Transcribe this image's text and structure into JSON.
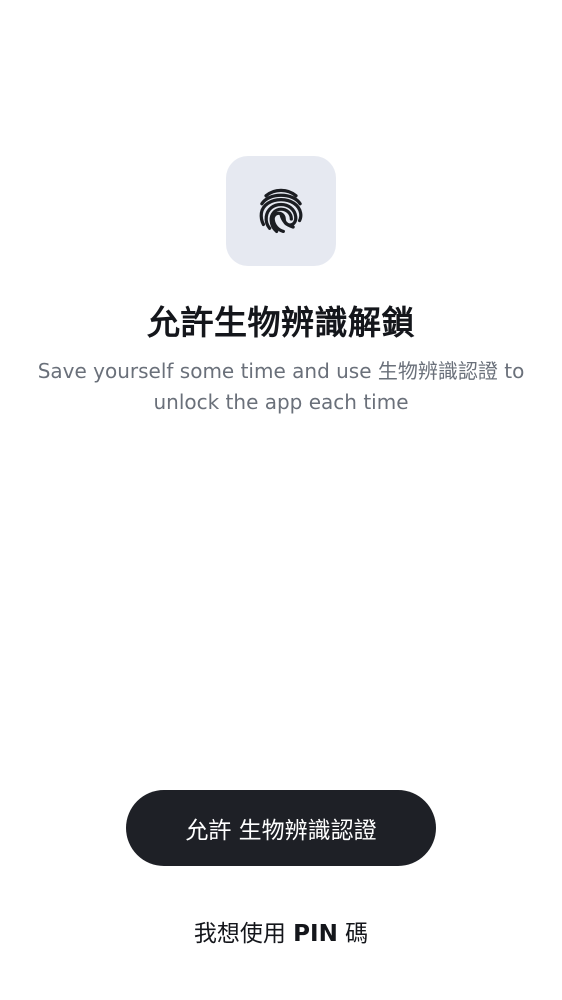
{
  "icon": {
    "name": "fingerprint-icon",
    "tile_color": "#e6e9f1",
    "stroke_color": "#1b1d22"
  },
  "title": "允許生物辨識解鎖",
  "subtitle": "Save yourself some time and use 生物辨識認證 to unlock the app each time",
  "primary_button": {
    "label": "允許 生物辨識認證",
    "background": "#1e2026"
  },
  "secondary_link": {
    "prefix": "我想使用 ",
    "pin": "PIN",
    "suffix": " 碼"
  }
}
